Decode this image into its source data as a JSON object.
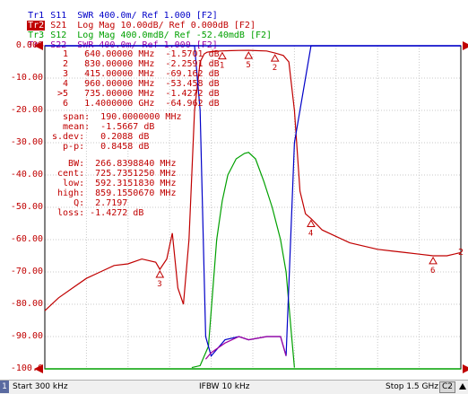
{
  "traces": [
    {
      "label": "Tr1",
      "desc": "S11  SWR 400.0m/ Ref 1.000 [F2]",
      "color": "#0000c8",
      "active": false
    },
    {
      "label": "Tr2",
      "desc": "S21  Log Mag 10.00dB/ Ref 0.000dB [F2]",
      "color": "#c00000",
      "active": true
    },
    {
      "label": "Tr3",
      "desc": "S12  Log Mag 400.0mdB/ Ref -52.40mdB [F2]",
      "color": "#00a000",
      "active": false
    },
    {
      "label": "Tr4",
      "desc": "S22  SWR 400.0m/ Ref 1.000 [F2]",
      "color": "#a000a0",
      "active": false
    }
  ],
  "y_axis": [
    "0.000",
    "-10.00",
    "-20.00",
    "-30.00",
    "-40.00",
    "-50.00",
    "-60.00",
    "-70.00",
    "-80.00",
    "-90.00",
    "-100.0"
  ],
  "marker_table": [
    "  1   640.00000 MHz  -1.5701 dB",
    "  2   830.00000 MHz  -2.2591 dB",
    "  3   415.00000 MHz  -69.162 dB",
    "  4   960.00000 MHz  -53.458 dB",
    " >5   735.00000 MHz  -1.4272 dB",
    "  6   1.4000000 GHz  -64.962 dB"
  ],
  "stats": [
    "  span:  190.0000000 MHz",
    "  mean:  -1.5667 dB",
    "s.dev:   0.2088 dB",
    "  p-p:   0.8458 dB"
  ],
  "bw": [
    "   BW:  266.8398840 MHz",
    " cent:  725.7351250 MHz",
    "  low:  592.3151830 MHz",
    " high:  859.1550670 MHz",
    "    Q:  2.7197",
    " loss: -1.4272 dB"
  ],
  "chart_data": {
    "type": "line",
    "title": "",
    "xlabel": "",
    "ylabel": "",
    "x_range_mhz": [
      0.3,
      1500
    ],
    "ylim": [
      -100,
      0
    ],
    "grid": true,
    "series": [
      {
        "name": "Tr2 S21",
        "color": "#c00000",
        "x": [
          0.3,
          50,
          100,
          150,
          200,
          250,
          300,
          350,
          400,
          415,
          440,
          460,
          480,
          500,
          520,
          540,
          560,
          575,
          585,
          600,
          620,
          640,
          700,
          735,
          800,
          830,
          860,
          880,
          900,
          920,
          940,
          960,
          1000,
          1050,
          1100,
          1150,
          1200,
          1250,
          1300,
          1350,
          1400,
          1450,
          1500
        ],
        "values": [
          -82,
          -78,
          -75,
          -72,
          -70,
          -68,
          -67.5,
          -66,
          -67,
          -69.2,
          -66,
          -58,
          -75,
          -80,
          -60,
          -20,
          -5,
          -2.5,
          -2,
          -1.8,
          -1.7,
          -1.57,
          -1.45,
          -1.43,
          -1.6,
          -2.26,
          -3,
          -5,
          -20,
          -45,
          -52,
          -53.5,
          -57,
          -59,
          -61,
          -62,
          -63,
          -63.5,
          -64,
          -64.5,
          -65,
          -65,
          -64
        ]
      },
      {
        "name": "Tr3 S12",
        "color": "#00a000",
        "x": [
          530,
          560,
          590,
          620,
          640,
          660,
          690,
          720,
          735,
          760,
          790,
          820,
          850,
          870,
          890,
          900
        ],
        "values": [
          -99.6,
          -99.0,
          -93.0,
          -60,
          -48,
          -40,
          -35,
          -33.3,
          -33.0,
          -35,
          -42,
          -50,
          -60,
          -70,
          -90,
          -99.6
        ]
      },
      {
        "name": "Tr1 S11",
        "color": "#0000c8",
        "x": [
          0.3,
          540,
          560,
          580,
          600,
          650,
          700,
          735,
          800,
          850,
          870,
          900,
          960,
          1500
        ],
        "values": [
          0,
          0,
          -20,
          -90,
          -96,
          -91,
          -90,
          -91,
          -90,
          -90,
          -96,
          -30,
          0,
          0
        ]
      },
      {
        "name": "Tr4 S22",
        "color": "#a000a0",
        "x": [
          580,
          600,
          650,
          700,
          735,
          800,
          850,
          870
        ],
        "values": [
          -97,
          -95,
          -92,
          -90,
          -91,
          -90,
          -90,
          -96
        ]
      }
    ],
    "markers": [
      {
        "id": "1",
        "x": 640,
        "y": -1.57
      },
      {
        "id": "2",
        "x": 830,
        "y": -2.26
      },
      {
        "id": "3",
        "x": 415,
        "y": -69.16
      },
      {
        "id": "4",
        "x": 960,
        "y": -53.46
      },
      {
        "id": "5",
        "x": 735,
        "y": -1.43
      },
      {
        "id": "6",
        "x": 1400,
        "y": -64.96
      }
    ]
  },
  "status": {
    "channel": "1",
    "start": "Start 300 kHz",
    "ifbw": "IFBW 10 kHz",
    "stop": "Stop 1.5 GHz",
    "c2": "C2"
  },
  "right_tag": "2"
}
